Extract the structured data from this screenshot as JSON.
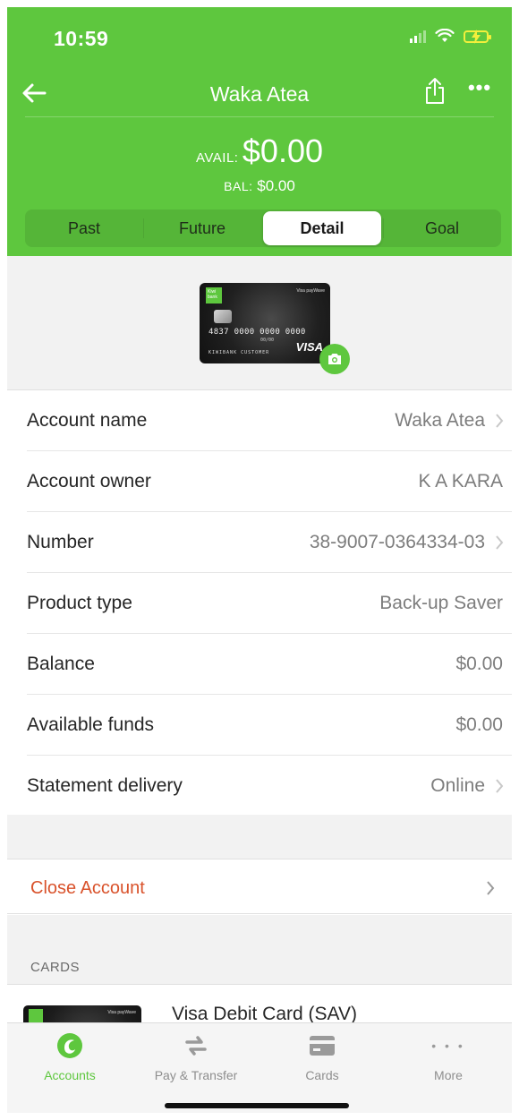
{
  "status_bar": {
    "time": "10:59"
  },
  "header": {
    "title": "Waka Atea",
    "avail_label": "AVAIL:",
    "avail_value": "$0.00",
    "bal_label": "BAL:",
    "bal_value": "$0.00",
    "tabs": [
      {
        "label": "Past",
        "active": false
      },
      {
        "label": "Future",
        "active": false
      },
      {
        "label": "Detail",
        "active": true
      },
      {
        "label": "Goal",
        "active": false
      }
    ]
  },
  "card_image": {
    "number": "4837 0000 0000 0000",
    "expiry": "00/00",
    "holder": "KIWIBANK CUSTOMER",
    "brand": "VISA",
    "paywave": "Visa payWave",
    "bank": "Kiwi bank"
  },
  "details": [
    {
      "label": "Account name",
      "value": "Waka Atea",
      "chevron": true
    },
    {
      "label": "Account owner",
      "value": "K A KARA",
      "chevron": false
    },
    {
      "label": "Number",
      "value": "38-9007-0364334-03",
      "chevron": true
    },
    {
      "label": "Product type",
      "value": "Back-up Saver",
      "chevron": false
    },
    {
      "label": "Balance",
      "value": "$0.00",
      "chevron": false
    },
    {
      "label": "Available funds",
      "value": "$0.00",
      "chevron": false
    },
    {
      "label": "Statement delivery",
      "value": "Online",
      "chevron": true
    }
  ],
  "close_account": {
    "label": "Close Account"
  },
  "cards_section": {
    "heading": "CARDS",
    "items": [
      {
        "title": "Visa Debit Card (SAV)"
      }
    ]
  },
  "tabbar": {
    "items": [
      {
        "label": "Accounts",
        "icon": "accounts-icon",
        "active": true
      },
      {
        "label": "Pay & Transfer",
        "icon": "transfer-icon",
        "active": false
      },
      {
        "label": "Cards",
        "icon": "card-icon",
        "active": false
      },
      {
        "label": "More",
        "icon": "more-icon",
        "active": false
      }
    ]
  },
  "colors": {
    "brand_green": "#5ec73e",
    "danger": "#d9522b",
    "muted": "#7d7d7d"
  }
}
